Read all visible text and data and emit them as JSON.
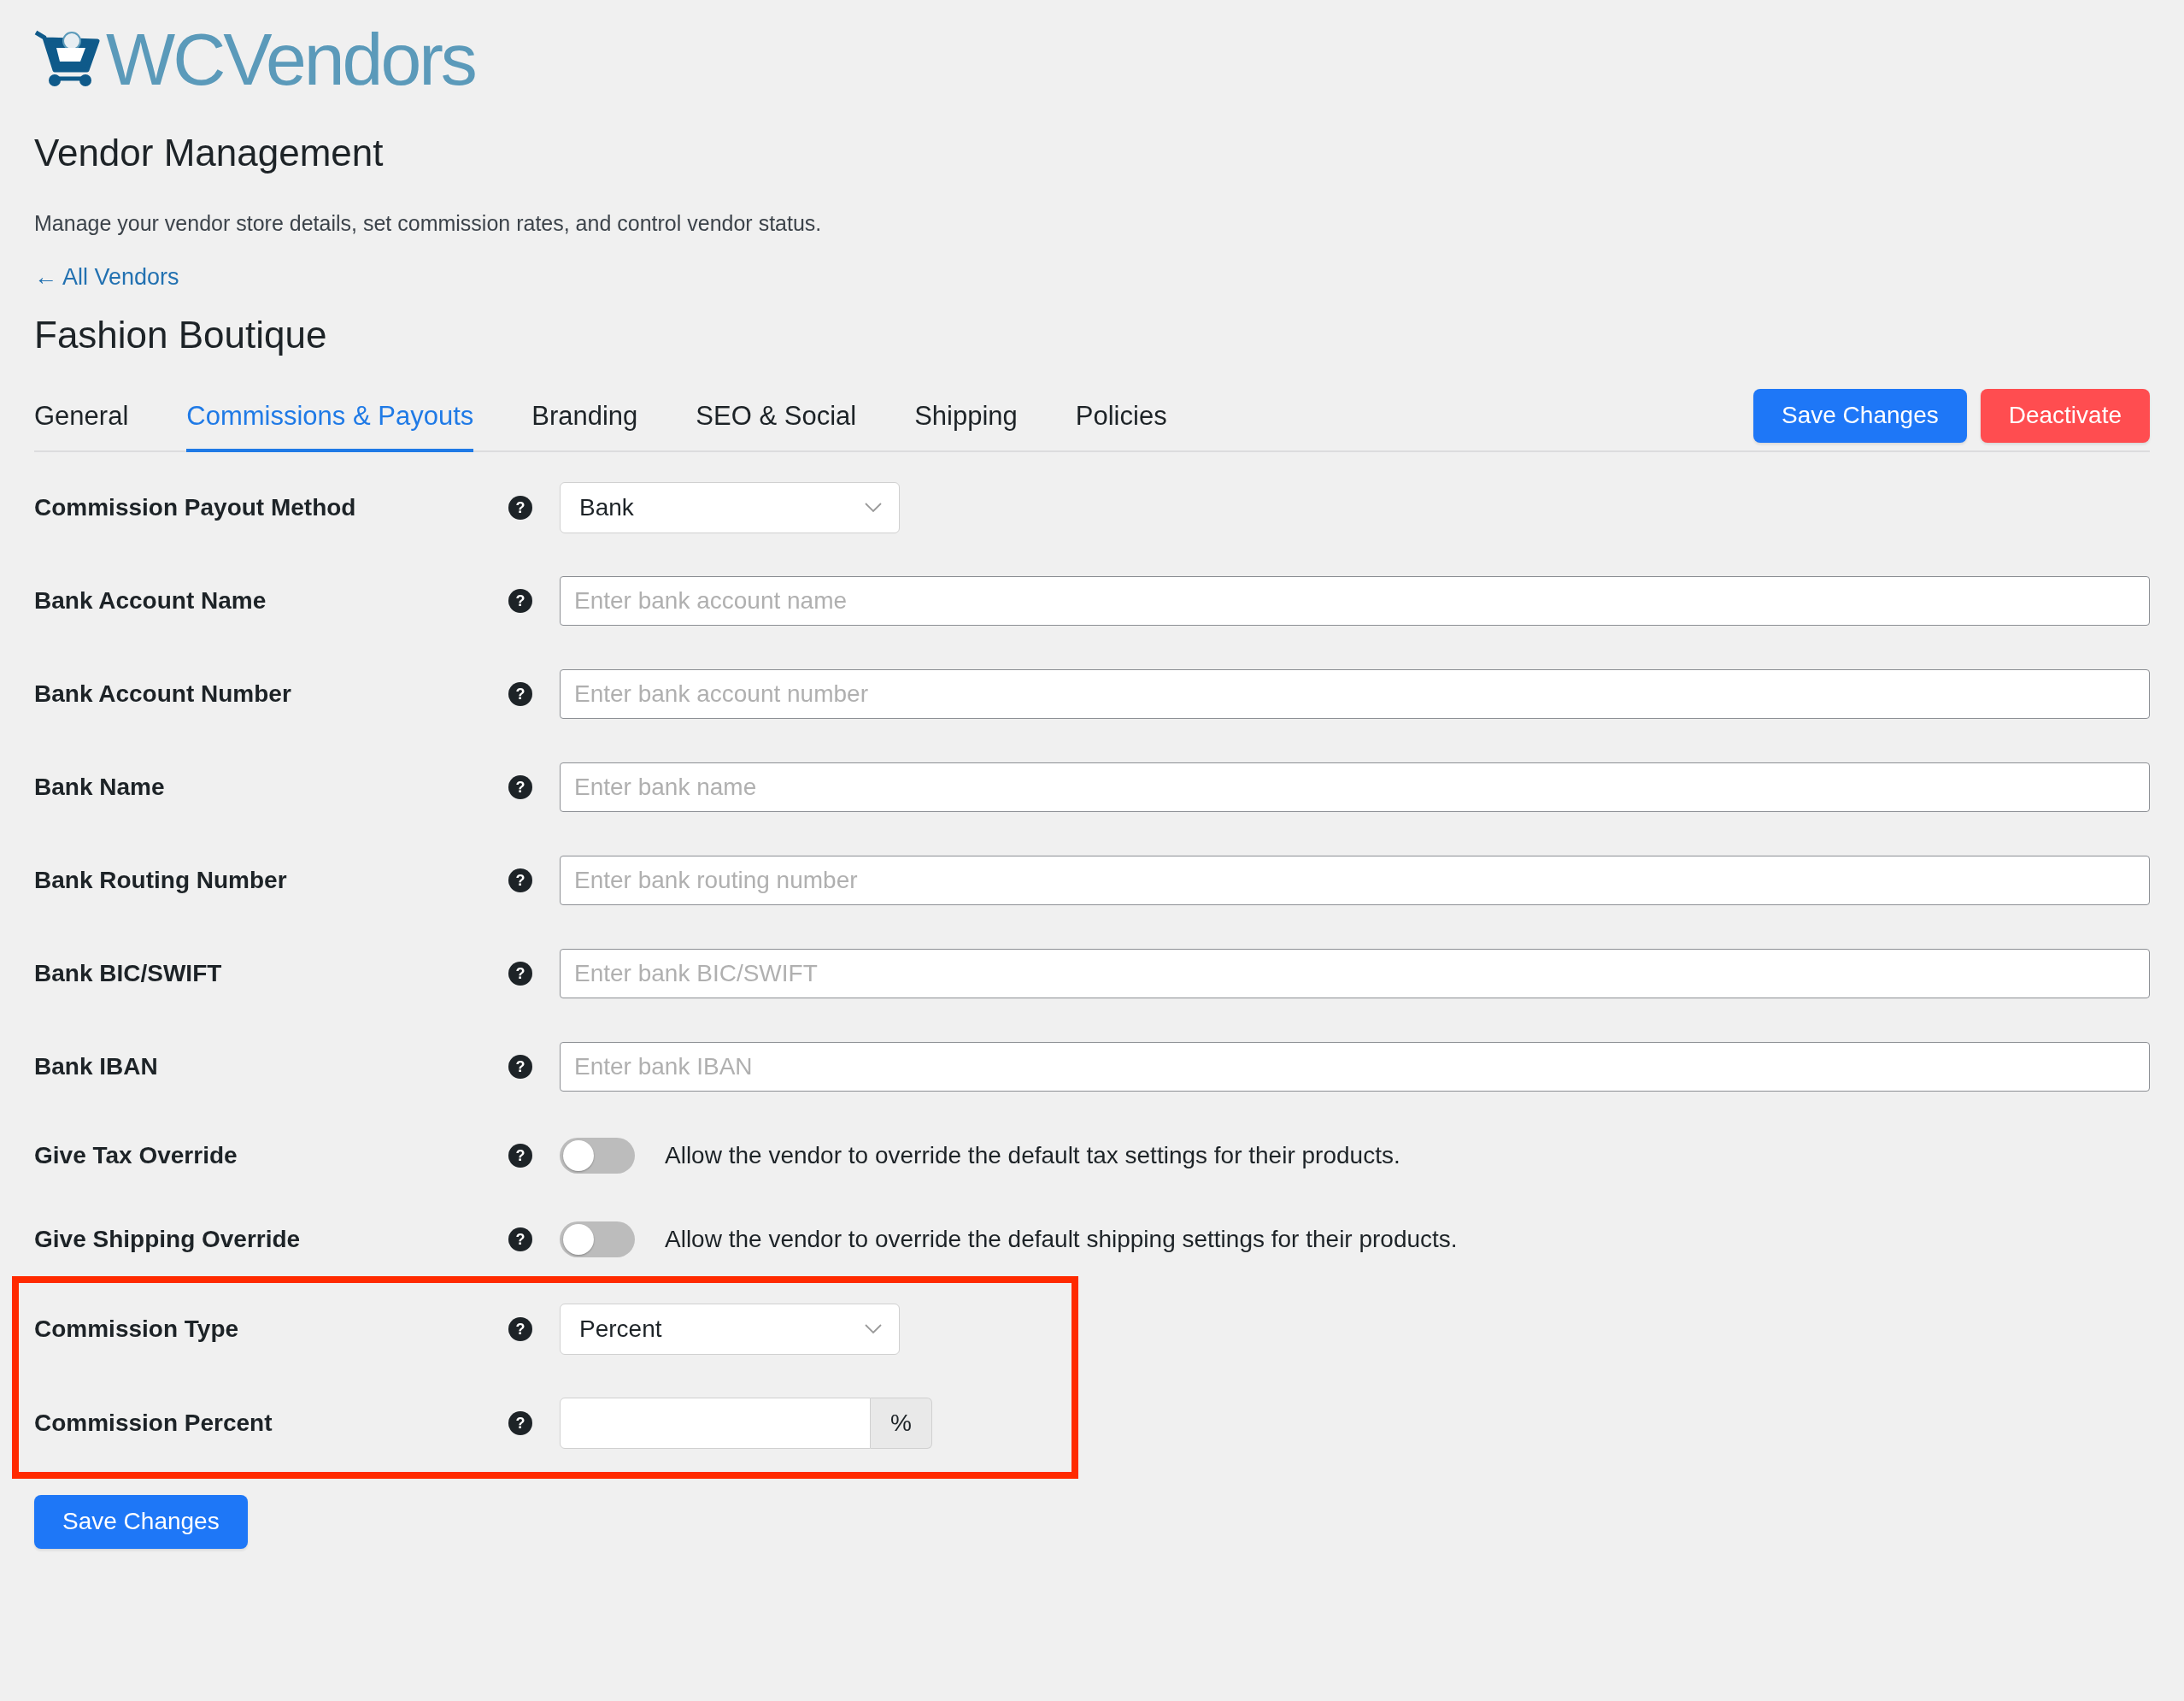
{
  "logo": {
    "text": "WCVendors"
  },
  "page_title": "Vendor Management",
  "description": "Manage your vendor store details, set commission rates, and control vendor status.",
  "back_link": {
    "arrow": "←",
    "label": "All Vendors"
  },
  "vendor_name": "Fashion Boutique",
  "tabs": [
    {
      "label": "General",
      "selected": false
    },
    {
      "label": "Commissions & Payouts",
      "selected": true
    },
    {
      "label": "Branding",
      "selected": false
    },
    {
      "label": "SEO & Social",
      "selected": false
    },
    {
      "label": "Shipping",
      "selected": false
    },
    {
      "label": "Policies",
      "selected": false
    }
  ],
  "header_buttons": [
    {
      "label": "Save Changes",
      "kind": "primary"
    },
    {
      "label": "Deactivate",
      "kind": "danger"
    }
  ],
  "fields": [
    {
      "label": "Commission Payout Method",
      "help": "?",
      "kind": "select",
      "value": "Bank"
    },
    {
      "label": "Bank Account Name",
      "help": "?",
      "kind": "text",
      "placeholder": "Enter bank account name"
    },
    {
      "label": "Bank Account Number",
      "help": "?",
      "kind": "text",
      "placeholder": "Enter bank account number"
    },
    {
      "label": "Bank Name",
      "help": "?",
      "kind": "text",
      "placeholder": "Enter bank name"
    },
    {
      "label": "Bank Routing Number",
      "help": "?",
      "kind": "text",
      "placeholder": "Enter bank routing number"
    },
    {
      "label": "Bank BIC/SWIFT",
      "help": "?",
      "kind": "text",
      "placeholder": "Enter bank BIC/SWIFT"
    },
    {
      "label": "Bank IBAN",
      "help": "?",
      "kind": "text",
      "placeholder": "Enter bank IBAN"
    },
    {
      "label": "Give Tax Override",
      "help": "?",
      "kind": "toggle",
      "on": false,
      "description": "Allow the vendor to override the default tax settings for their products."
    },
    {
      "label": "Give Shipping Override",
      "help": "?",
      "kind": "toggle",
      "on": false,
      "description": "Allow the vendor to override the default shipping settings for their products."
    }
  ],
  "highlighted_fields": [
    {
      "label": "Commission Type",
      "help": "?",
      "kind": "select",
      "value": "Percent"
    },
    {
      "label": "Commission Percent",
      "help": "?",
      "kind": "addon",
      "suffix": "%"
    }
  ],
  "footer_button": {
    "label": "Save Changes"
  }
}
